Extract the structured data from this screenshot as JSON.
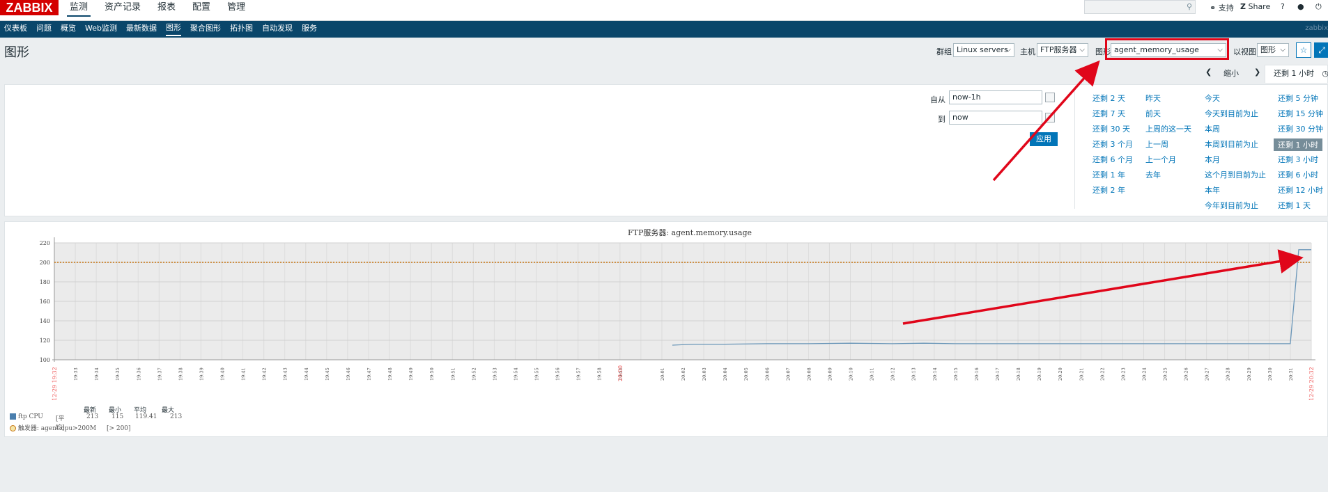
{
  "topbar": {
    "logo": "ZABBIX",
    "menu": [
      "监测",
      "资产记录",
      "报表",
      "配置",
      "管理"
    ],
    "support": "支持",
    "share": "Share",
    "help": "?"
  },
  "submenu": {
    "items": [
      "仪表板",
      "问题",
      "概览",
      "Web监测",
      "最新数据",
      "图形",
      "聚合图形",
      "拓扑图",
      "自动发现",
      "服务"
    ],
    "active_index": 5,
    "right_text": "zabbix"
  },
  "page": {
    "title": "图形",
    "group_label": "群组",
    "group_value": "Linux servers",
    "host_label": "主机",
    "host_value": "FTP服务器",
    "graph_label": "图形",
    "graph_value": "agent_memory_usage",
    "view_label": "以视图",
    "view_value": "图形"
  },
  "timebar": {
    "zoom_out": "缩小",
    "active_tab": "还剩 1 小时"
  },
  "filter": {
    "from_label": "自从",
    "from_value": "now-1h",
    "to_label": "到",
    "to_value": "now",
    "apply": "应用"
  },
  "quick_ranges": {
    "col1": [
      "还剩 2 天",
      "还剩 7 天",
      "还剩 30 天",
      "还剩 3 个月",
      "还剩 6 个月",
      "还剩 1 年",
      "还剩 2 年"
    ],
    "col2": [
      "昨天",
      "前天",
      "上周的这一天",
      "上一周",
      "上一个月",
      "去年"
    ],
    "col3": [
      "今天",
      "今天到目前为止",
      "本周",
      "本周到目前为止",
      "本月",
      "这个月到目前为止",
      "本年",
      "今年到目前为止"
    ],
    "col4": [
      "还剩 5 分钟",
      "还剩 15 分钟",
      "还剩 30 分钟",
      "还剩 1 小时",
      "还剩 3 小时",
      "还剩 6 小时",
      "还剩 12 小时",
      "还剩 1 天"
    ],
    "selected": "还剩 1 小时"
  },
  "chart_data": {
    "type": "line",
    "title": "FTP服务器: agent.memory.usage",
    "ylim": [
      100,
      220
    ],
    "yticks": [
      100,
      120,
      140,
      160,
      180,
      200,
      220
    ],
    "x_start_label": "12-29 19:32",
    "x_end_label": "12-29 20:32",
    "x_mid_label": "20:00",
    "xticks": [
      "19:33",
      "19:34",
      "19:35",
      "19:36",
      "19:37",
      "19:38",
      "19:39",
      "19:40",
      "19:41",
      "19:42",
      "19:43",
      "19:44",
      "19:45",
      "19:46",
      "19:47",
      "19:48",
      "19:49",
      "19:50",
      "19:51",
      "19:52",
      "19:53",
      "19:54",
      "19:55",
      "19:56",
      "19:57",
      "19:58",
      "19:59",
      "20:00",
      "20:01",
      "20:02",
      "20:03",
      "20:04",
      "20:05",
      "20:06",
      "20:07",
      "20:08",
      "20:09",
      "20:10",
      "20:11",
      "20:12",
      "20:13",
      "20:14",
      "20:15",
      "20:16",
      "20:17",
      "20:18",
      "20:19",
      "20:20",
      "20:21",
      "20:22",
      "20:23",
      "20:24",
      "20:25",
      "20:26",
      "20:27",
      "20:28",
      "20:29",
      "20:30",
      "20:31",
      "20:32"
    ],
    "series": [
      {
        "name": "ftp CPU",
        "color": "#6a96b8",
        "x": [
          29.5,
          30.5,
          32,
          34,
          36,
          38,
          40,
          41.5,
          43,
          45,
          47,
          49,
          51,
          53,
          55,
          57,
          59,
          59.4,
          60
        ],
        "values": [
          115,
          116,
          116,
          116.5,
          116.5,
          117,
          116.5,
          117,
          116.5,
          116.5,
          116.5,
          116.5,
          116.5,
          116.5,
          116.5,
          116.5,
          116.5,
          213,
          213
        ]
      }
    ],
    "threshold": {
      "name": "agent.cpu>200M",
      "value": 200,
      "color": "#c6730d"
    },
    "legend": {
      "headers": [
        "最新",
        "最小",
        "平均",
        "最大"
      ],
      "row_name": "ftp CPU",
      "row_mode": "[平均]",
      "row_values": [
        "213",
        "115",
        "119.41",
        "213"
      ],
      "trigger_label": "触发器:",
      "trigger_name": "agent.cpu>200M",
      "trigger_cond": "[> 200]"
    }
  }
}
